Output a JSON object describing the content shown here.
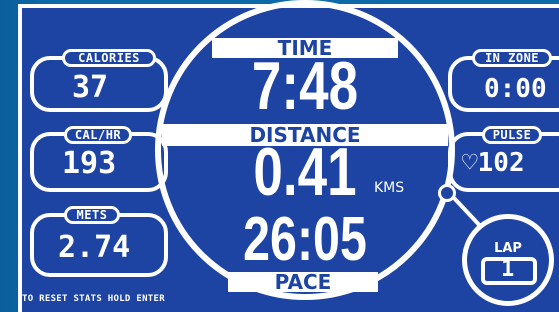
{
  "stats_left": [
    {
      "label": "CALORIES",
      "value": "37"
    },
    {
      "label": "CAL/HR",
      "value": "193"
    },
    {
      "label": "METS",
      "value": "2.74"
    }
  ],
  "stats_right": [
    {
      "label": "IN ZONE",
      "value": "0:00"
    },
    {
      "label": "PULSE",
      "value": "♡102"
    }
  ],
  "center": {
    "time_label": "TIME",
    "time_value": "7:48",
    "distance_label": "DISTANCE",
    "distance_value": "0.41",
    "distance_unit": "KMS",
    "pace_value": "26:05",
    "pace_label": "PACE"
  },
  "lap": {
    "label": "LAP",
    "value": "1"
  },
  "footer": {
    "message": "TO RESET STATS HOLD ENTER"
  },
  "colors": {
    "panel_bg": "#1d44a3",
    "frame": "#ffffff",
    "outer_bg": "#0d6aa8"
  }
}
